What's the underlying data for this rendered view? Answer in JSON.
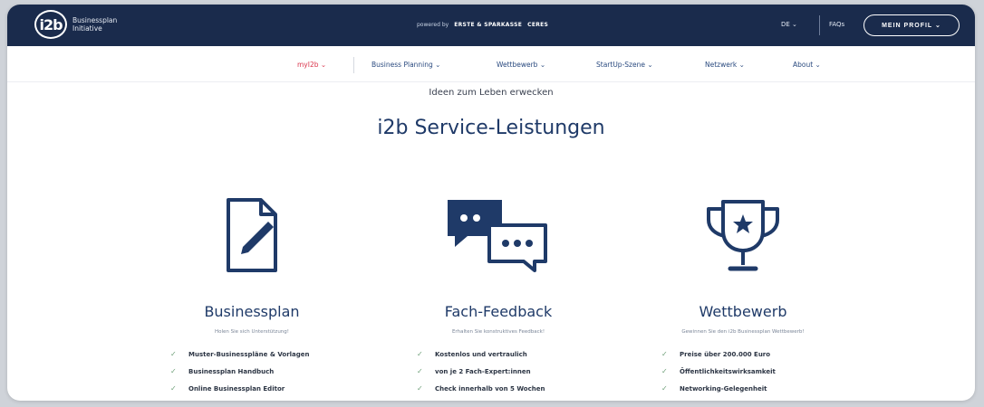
{
  "header": {
    "logo_mark": "i2b",
    "logo_line1": "Businessplan",
    "logo_line2": "Initiative",
    "powered_by": "powered by",
    "partner1": "ERSTE & SPARKASSE",
    "partner2": "CERES",
    "lang": "DE ⌄",
    "faqs": "FAQs",
    "profile_button": "MEIN PROFIL ⌄"
  },
  "nav": {
    "items": [
      {
        "label": "myI2b ⌄"
      },
      {
        "label": "Business Planning ⌄"
      },
      {
        "label": "Wettbewerb ⌄"
      },
      {
        "label": "StartUp-Szene ⌄"
      },
      {
        "label": "Netzwerk ⌄"
      },
      {
        "label": "About ⌄"
      }
    ]
  },
  "main": {
    "tagline": "Ideen zum Leben erwecken",
    "title": "i2b Service-Leistungen",
    "columns": [
      {
        "icon": "document-edit-icon",
        "title": "Businessplan",
        "subtitle": "Holen Sie sich Unterstützung!",
        "items": [
          "Muster-Businesspläne & Vorlagen",
          "Businessplan Handbuch",
          "Online Businessplan Editor"
        ]
      },
      {
        "icon": "chat-bubbles-icon",
        "title": "Fach-Feedback",
        "subtitle": "Erhalten Sie konstruktives Feedback!",
        "items": [
          "Kostenlos und vertraulich",
          "von je 2 Fach-Expert:innen",
          "Check innerhalb von 5 Wochen"
        ]
      },
      {
        "icon": "trophy-icon",
        "title": "Wettbewerb",
        "subtitle": "Gewinnen Sie den i2b Businessplan Wettbewerb!",
        "items": [
          "Preise über 200.000 Euro",
          "Öffentlichkeitswirksamkeit",
          "Networking-Gelegenheit"
        ]
      }
    ]
  },
  "colors": {
    "header_bg": "#1a2b4c",
    "accent_blue": "#1f3a68",
    "active_red": "#d9334a",
    "check_green": "#6fa07a"
  }
}
